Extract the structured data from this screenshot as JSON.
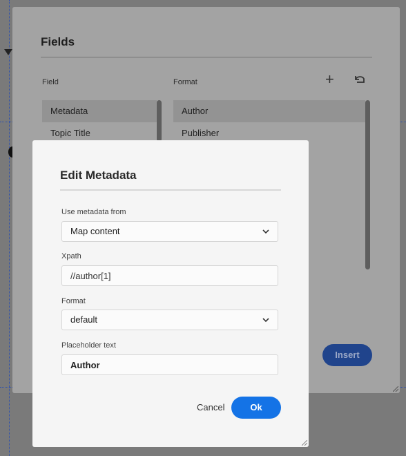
{
  "fields_dialog": {
    "title": "Fields",
    "field_column_label": "Field",
    "format_column_label": "Format",
    "add_icon": "plus-icon",
    "reset_icon": "undo-icon",
    "field_items": [
      "Metadata",
      "Topic Title"
    ],
    "format_items": [
      "Author",
      "Publisher"
    ],
    "insert_label": "Insert"
  },
  "edit_dialog": {
    "title": "Edit Metadata",
    "use_metadata_label": "Use metadata from",
    "use_metadata_value": "Map content",
    "xpath_label": "Xpath",
    "xpath_value": "//author[1]",
    "format_label": "Format",
    "format_value": "default",
    "placeholder_label": "Placeholder text",
    "placeholder_value": "Author",
    "cancel_label": "Cancel",
    "ok_label": "Ok"
  },
  "colors": {
    "overlay": "#7a7a7a",
    "dialog_bg": "#f5f5f5",
    "primary_button": "#1473e6"
  }
}
